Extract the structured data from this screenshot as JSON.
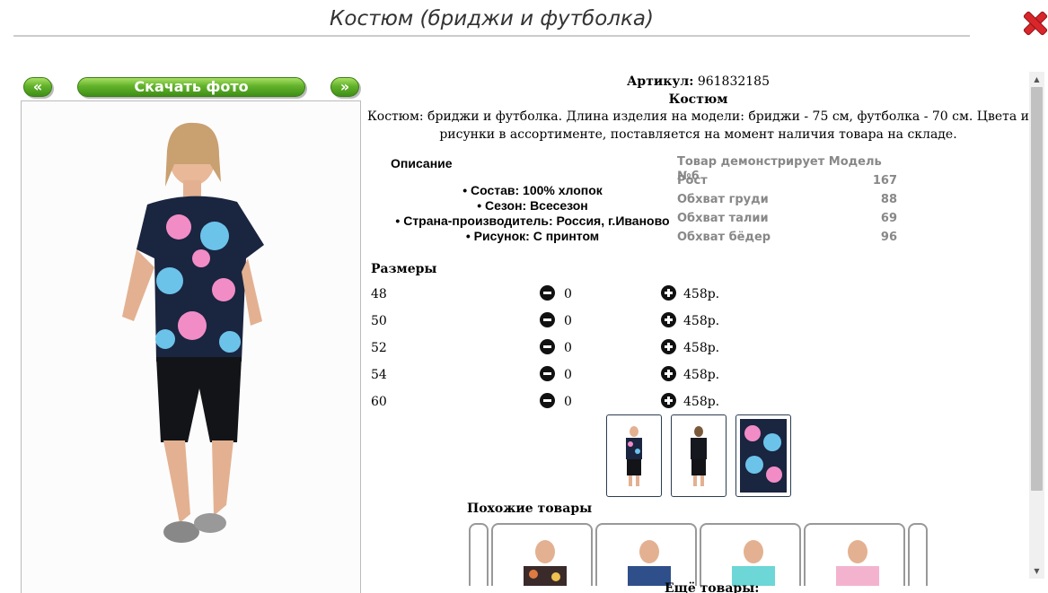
{
  "title": "Костюм (бриджи и футболка)",
  "nav": {
    "prev": "«",
    "download": "Скачать фото",
    "next": "»"
  },
  "product": {
    "article_label": "Артикул:",
    "article_value": "961832185",
    "name": "Костюм",
    "description": "Костюм: бриджи и футболка. Длина изделия на модели: бриджи - 75 см, футболка - 70 см. Цвета и рисунки в ассортименте, поставляется на момент наличия товара на складе."
  },
  "specs": {
    "heading": "Описание",
    "items": [
      "• Состав: 100% хлопок",
      "• Сезон: Всесезон",
      "• Страна-производитель: Россия, г.Иваново",
      "• Рисунок: С принтом"
    ]
  },
  "model": {
    "heading": "Товар демонстрирует Модель №6",
    "rows": [
      {
        "label": "Рост",
        "value": "167"
      },
      {
        "label": "Обхват груди",
        "value": "88"
      },
      {
        "label": "Обхват талии",
        "value": "69"
      },
      {
        "label": "Обхват бёдер",
        "value": "96"
      }
    ]
  },
  "sizes": {
    "heading": "Размеры",
    "rows": [
      {
        "size": "48",
        "qty": "0",
        "price": "458р."
      },
      {
        "size": "50",
        "qty": "0",
        "price": "458р."
      },
      {
        "size": "52",
        "qty": "0",
        "price": "458р."
      },
      {
        "size": "54",
        "qty": "0",
        "price": "458р."
      },
      {
        "size": "60",
        "qty": "0",
        "price": "458р."
      }
    ]
  },
  "similar": {
    "heading": "Похожие товары"
  },
  "more": {
    "heading": "Ещё товары:"
  },
  "colors": {
    "accent_green": "#62b22b",
    "close_red": "#d9262b",
    "muted_gray": "#888888"
  }
}
